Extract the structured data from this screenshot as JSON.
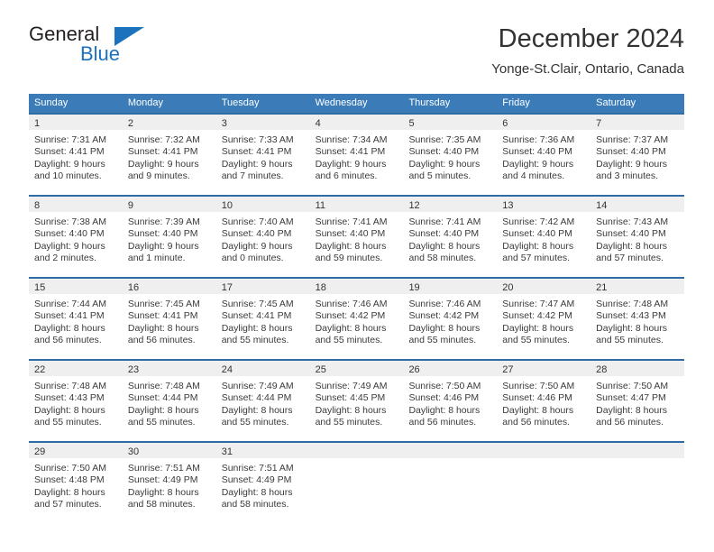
{
  "brand": {
    "name_top": "General",
    "name_bottom": "Blue",
    "color_primary": "#1c72bd",
    "color_text": "#231f20"
  },
  "header": {
    "title": "December 2024",
    "subtitle": "Yonge-St.Clair, Ontario, Canada"
  },
  "theme": {
    "header_bar_bg": "#3b7cb8",
    "week_rule": "#2d6da3",
    "day_band_bg": "#efefef",
    "text": "#333333"
  },
  "weekdays": [
    "Sunday",
    "Monday",
    "Tuesday",
    "Wednesday",
    "Thursday",
    "Friday",
    "Saturday"
  ],
  "weeks": [
    [
      {
        "day": "1",
        "sunrise": "Sunrise: 7:31 AM",
        "sunset": "Sunset: 4:41 PM",
        "daylight_1": "Daylight: 9 hours",
        "daylight_2": "and 10 minutes."
      },
      {
        "day": "2",
        "sunrise": "Sunrise: 7:32 AM",
        "sunset": "Sunset: 4:41 PM",
        "daylight_1": "Daylight: 9 hours",
        "daylight_2": "and 9 minutes."
      },
      {
        "day": "3",
        "sunrise": "Sunrise: 7:33 AM",
        "sunset": "Sunset: 4:41 PM",
        "daylight_1": "Daylight: 9 hours",
        "daylight_2": "and 7 minutes."
      },
      {
        "day": "4",
        "sunrise": "Sunrise: 7:34 AM",
        "sunset": "Sunset: 4:41 PM",
        "daylight_1": "Daylight: 9 hours",
        "daylight_2": "and 6 minutes."
      },
      {
        "day": "5",
        "sunrise": "Sunrise: 7:35 AM",
        "sunset": "Sunset: 4:40 PM",
        "daylight_1": "Daylight: 9 hours",
        "daylight_2": "and 5 minutes."
      },
      {
        "day": "6",
        "sunrise": "Sunrise: 7:36 AM",
        "sunset": "Sunset: 4:40 PM",
        "daylight_1": "Daylight: 9 hours",
        "daylight_2": "and 4 minutes."
      },
      {
        "day": "7",
        "sunrise": "Sunrise: 7:37 AM",
        "sunset": "Sunset: 4:40 PM",
        "daylight_1": "Daylight: 9 hours",
        "daylight_2": "and 3 minutes."
      }
    ],
    [
      {
        "day": "8",
        "sunrise": "Sunrise: 7:38 AM",
        "sunset": "Sunset: 4:40 PM",
        "daylight_1": "Daylight: 9 hours",
        "daylight_2": "and 2 minutes."
      },
      {
        "day": "9",
        "sunrise": "Sunrise: 7:39 AM",
        "sunset": "Sunset: 4:40 PM",
        "daylight_1": "Daylight: 9 hours",
        "daylight_2": "and 1 minute."
      },
      {
        "day": "10",
        "sunrise": "Sunrise: 7:40 AM",
        "sunset": "Sunset: 4:40 PM",
        "daylight_1": "Daylight: 9 hours",
        "daylight_2": "and 0 minutes."
      },
      {
        "day": "11",
        "sunrise": "Sunrise: 7:41 AM",
        "sunset": "Sunset: 4:40 PM",
        "daylight_1": "Daylight: 8 hours",
        "daylight_2": "and 59 minutes."
      },
      {
        "day": "12",
        "sunrise": "Sunrise: 7:41 AM",
        "sunset": "Sunset: 4:40 PM",
        "daylight_1": "Daylight: 8 hours",
        "daylight_2": "and 58 minutes."
      },
      {
        "day": "13",
        "sunrise": "Sunrise: 7:42 AM",
        "sunset": "Sunset: 4:40 PM",
        "daylight_1": "Daylight: 8 hours",
        "daylight_2": "and 57 minutes."
      },
      {
        "day": "14",
        "sunrise": "Sunrise: 7:43 AM",
        "sunset": "Sunset: 4:40 PM",
        "daylight_1": "Daylight: 8 hours",
        "daylight_2": "and 57 minutes."
      }
    ],
    [
      {
        "day": "15",
        "sunrise": "Sunrise: 7:44 AM",
        "sunset": "Sunset: 4:41 PM",
        "daylight_1": "Daylight: 8 hours",
        "daylight_2": "and 56 minutes."
      },
      {
        "day": "16",
        "sunrise": "Sunrise: 7:45 AM",
        "sunset": "Sunset: 4:41 PM",
        "daylight_1": "Daylight: 8 hours",
        "daylight_2": "and 56 minutes."
      },
      {
        "day": "17",
        "sunrise": "Sunrise: 7:45 AM",
        "sunset": "Sunset: 4:41 PM",
        "daylight_1": "Daylight: 8 hours",
        "daylight_2": "and 55 minutes."
      },
      {
        "day": "18",
        "sunrise": "Sunrise: 7:46 AM",
        "sunset": "Sunset: 4:42 PM",
        "daylight_1": "Daylight: 8 hours",
        "daylight_2": "and 55 minutes."
      },
      {
        "day": "19",
        "sunrise": "Sunrise: 7:46 AM",
        "sunset": "Sunset: 4:42 PM",
        "daylight_1": "Daylight: 8 hours",
        "daylight_2": "and 55 minutes."
      },
      {
        "day": "20",
        "sunrise": "Sunrise: 7:47 AM",
        "sunset": "Sunset: 4:42 PM",
        "daylight_1": "Daylight: 8 hours",
        "daylight_2": "and 55 minutes."
      },
      {
        "day": "21",
        "sunrise": "Sunrise: 7:48 AM",
        "sunset": "Sunset: 4:43 PM",
        "daylight_1": "Daylight: 8 hours",
        "daylight_2": "and 55 minutes."
      }
    ],
    [
      {
        "day": "22",
        "sunrise": "Sunrise: 7:48 AM",
        "sunset": "Sunset: 4:43 PM",
        "daylight_1": "Daylight: 8 hours",
        "daylight_2": "and 55 minutes."
      },
      {
        "day": "23",
        "sunrise": "Sunrise: 7:48 AM",
        "sunset": "Sunset: 4:44 PM",
        "daylight_1": "Daylight: 8 hours",
        "daylight_2": "and 55 minutes."
      },
      {
        "day": "24",
        "sunrise": "Sunrise: 7:49 AM",
        "sunset": "Sunset: 4:44 PM",
        "daylight_1": "Daylight: 8 hours",
        "daylight_2": "and 55 minutes."
      },
      {
        "day": "25",
        "sunrise": "Sunrise: 7:49 AM",
        "sunset": "Sunset: 4:45 PM",
        "daylight_1": "Daylight: 8 hours",
        "daylight_2": "and 55 minutes."
      },
      {
        "day": "26",
        "sunrise": "Sunrise: 7:50 AM",
        "sunset": "Sunset: 4:46 PM",
        "daylight_1": "Daylight: 8 hours",
        "daylight_2": "and 56 minutes."
      },
      {
        "day": "27",
        "sunrise": "Sunrise: 7:50 AM",
        "sunset": "Sunset: 4:46 PM",
        "daylight_1": "Daylight: 8 hours",
        "daylight_2": "and 56 minutes."
      },
      {
        "day": "28",
        "sunrise": "Sunrise: 7:50 AM",
        "sunset": "Sunset: 4:47 PM",
        "daylight_1": "Daylight: 8 hours",
        "daylight_2": "and 56 minutes."
      }
    ],
    [
      {
        "day": "29",
        "sunrise": "Sunrise: 7:50 AM",
        "sunset": "Sunset: 4:48 PM",
        "daylight_1": "Daylight: 8 hours",
        "daylight_2": "and 57 minutes."
      },
      {
        "day": "30",
        "sunrise": "Sunrise: 7:51 AM",
        "sunset": "Sunset: 4:49 PM",
        "daylight_1": "Daylight: 8 hours",
        "daylight_2": "and 58 minutes."
      },
      {
        "day": "31",
        "sunrise": "Sunrise: 7:51 AM",
        "sunset": "Sunset: 4:49 PM",
        "daylight_1": "Daylight: 8 hours",
        "daylight_2": "and 58 minutes."
      },
      {
        "day": "",
        "sunrise": "",
        "sunset": "",
        "daylight_1": "",
        "daylight_2": ""
      },
      {
        "day": "",
        "sunrise": "",
        "sunset": "",
        "daylight_1": "",
        "daylight_2": ""
      },
      {
        "day": "",
        "sunrise": "",
        "sunset": "",
        "daylight_1": "",
        "daylight_2": ""
      },
      {
        "day": "",
        "sunrise": "",
        "sunset": "",
        "daylight_1": "",
        "daylight_2": ""
      }
    ]
  ]
}
